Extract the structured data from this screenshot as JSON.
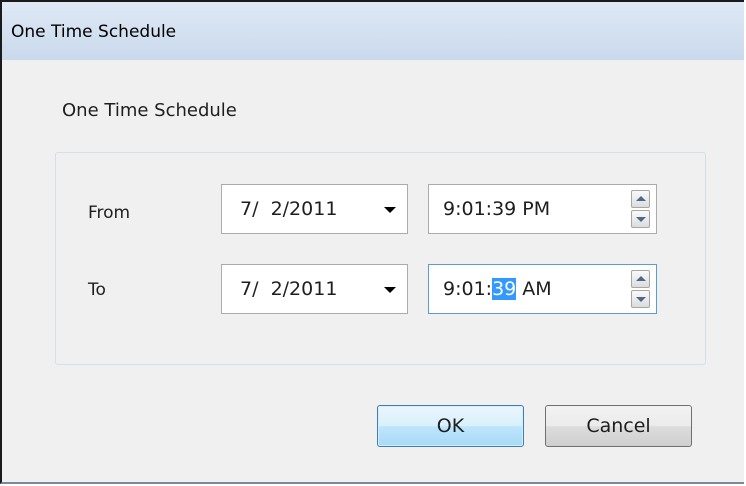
{
  "window": {
    "title": "One Time Schedule"
  },
  "header": {
    "label": "One Time Schedule"
  },
  "schedule": {
    "from": {
      "label": "From",
      "date": "7/  2/2011",
      "time": "9:01:39 PM"
    },
    "to": {
      "label": "To",
      "date": "7/  2/2011",
      "time_prefix": "9:01:",
      "time_selected": "39",
      "time_suffix": " AM"
    }
  },
  "buttons": {
    "ok": "OK",
    "cancel": "Cancel"
  },
  "colors": {
    "selection": "#3399ff",
    "default_button_border": "#3c7fb1"
  }
}
